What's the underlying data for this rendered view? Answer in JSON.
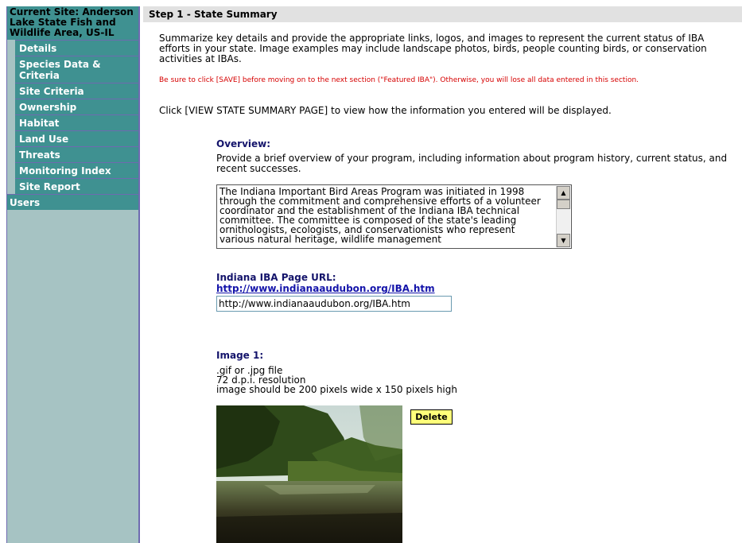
{
  "sidebar": {
    "current_site": "Current Site: Anderson Lake State Fish and Wildlife Area, US-IL",
    "items": [
      {
        "label": "Details"
      },
      {
        "label": "Species Data & Criteria"
      },
      {
        "label": "Site Criteria"
      },
      {
        "label": "Ownership"
      },
      {
        "label": "Habitat"
      },
      {
        "label": "Land Use"
      },
      {
        "label": "Threats"
      },
      {
        "label": "Monitoring Index"
      },
      {
        "label": "Site Report"
      }
    ],
    "users_label": "Users"
  },
  "main": {
    "step_title": "Step 1 - State Summary",
    "intro": "Summarize key details and provide the appropriate links, logos, and images to represent the current status of IBA efforts in your state. Image examples may include landscape photos, birds, people counting birds, or conservation activities at IBAs.",
    "warning": "Be sure to click [SAVE] before moving on to the next section (\"Featured IBA\"). Otherwise, you will lose all data entered in this section.",
    "view_note": "Click [VIEW STATE SUMMARY PAGE] to view how the information you entered will be displayed.",
    "overview": {
      "label": "Overview:",
      "description": "Provide a brief overview of your program, including information about program history, current status, and recent successes.",
      "text": "The Indiana Important Bird Areas Program was initiated in 1998 through the commitment and comprehensive efforts of a volunteer coordinator and the establishment of the Indiana IBA technical committee. The committee is composed of the state's leading ornithologists, ecologists, and conservationists who represent various natural heritage, wildlife management"
    },
    "url": {
      "label": "Indiana IBA Page URL:",
      "link_text": "http://www.indianaaudubon.org/IBA.htm",
      "input_value": "http://www.indianaaudubon.org/IBA.htm"
    },
    "image1": {
      "label": "Image 1:",
      "notes": [
        ".gif or .jpg file",
        "72 d.p.i. resolution",
        "image should be 200 pixels wide x 150 pixels high"
      ],
      "delete_label": "Delete"
    }
  },
  "colors": {
    "sidebar_bg": "#a6c3c3",
    "nav_bg": "#3f9191",
    "nav_border": "#6e6ab0",
    "warning": "#d60000",
    "label": "#14146b",
    "delete_bg": "#ffff7a"
  },
  "icons": {
    "scroll_up": "scroll-up-arrow-icon",
    "scroll_down": "scroll-down-arrow-icon"
  }
}
